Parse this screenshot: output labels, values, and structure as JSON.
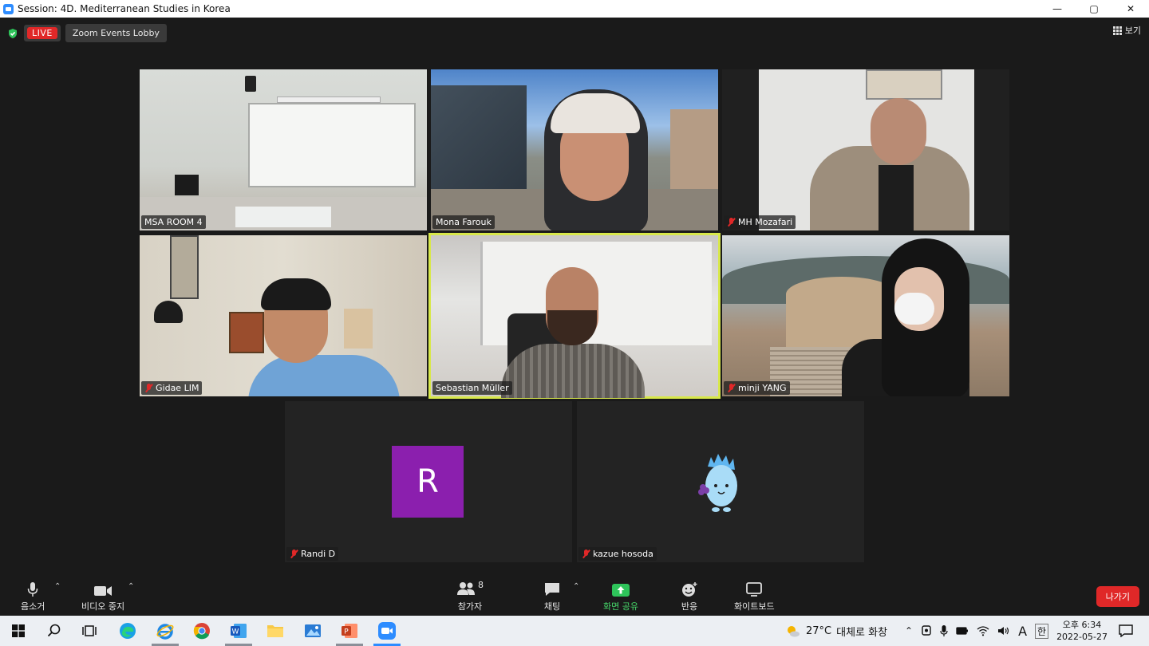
{
  "window": {
    "title": "Session: 4D. Mediterranean Studies in Korea",
    "minimize": "—",
    "restore": "▢",
    "close": "✕"
  },
  "header": {
    "live_label": "LIVE",
    "lobby_label": "Zoom Events Lobby",
    "view_label": "보기"
  },
  "tiles": [
    {
      "name": "MSA ROOM 4",
      "muted": false
    },
    {
      "name": "Mona Farouk",
      "muted": false
    },
    {
      "name": "MH Mozafari",
      "muted": true
    },
    {
      "name": "Gidae LIM",
      "muted": true
    },
    {
      "name": "Sebastian Müller",
      "muted": false,
      "active": true
    },
    {
      "name": "minji YANG",
      "muted": true
    },
    {
      "name": "Randi D",
      "muted": true,
      "avatar_letter": "R",
      "avatar_color": "#8b1fae"
    },
    {
      "name": "kazue hosoda",
      "muted": true
    }
  ],
  "toolbar": {
    "mute_label": "음소거",
    "video_label": "비디오 중지",
    "participants_label": "참가자",
    "participants_count": "8",
    "chat_label": "채팅",
    "share_label": "화면 공유",
    "reactions_label": "반응",
    "whiteboard_label": "화이트보드",
    "leave_label": "나가기"
  },
  "taskbar": {
    "weather_temp": "27°C",
    "weather_desc": "대체로 화창",
    "ime_mode": "A",
    "ime_lang": "한",
    "time": "오후 6:34",
    "date": "2022-05-27"
  },
  "colors": {
    "accent_live": "#e02828",
    "active_speaker": "#d8e84a",
    "share_green": "#46d86a",
    "zoom_blue": "#2d8cff"
  }
}
